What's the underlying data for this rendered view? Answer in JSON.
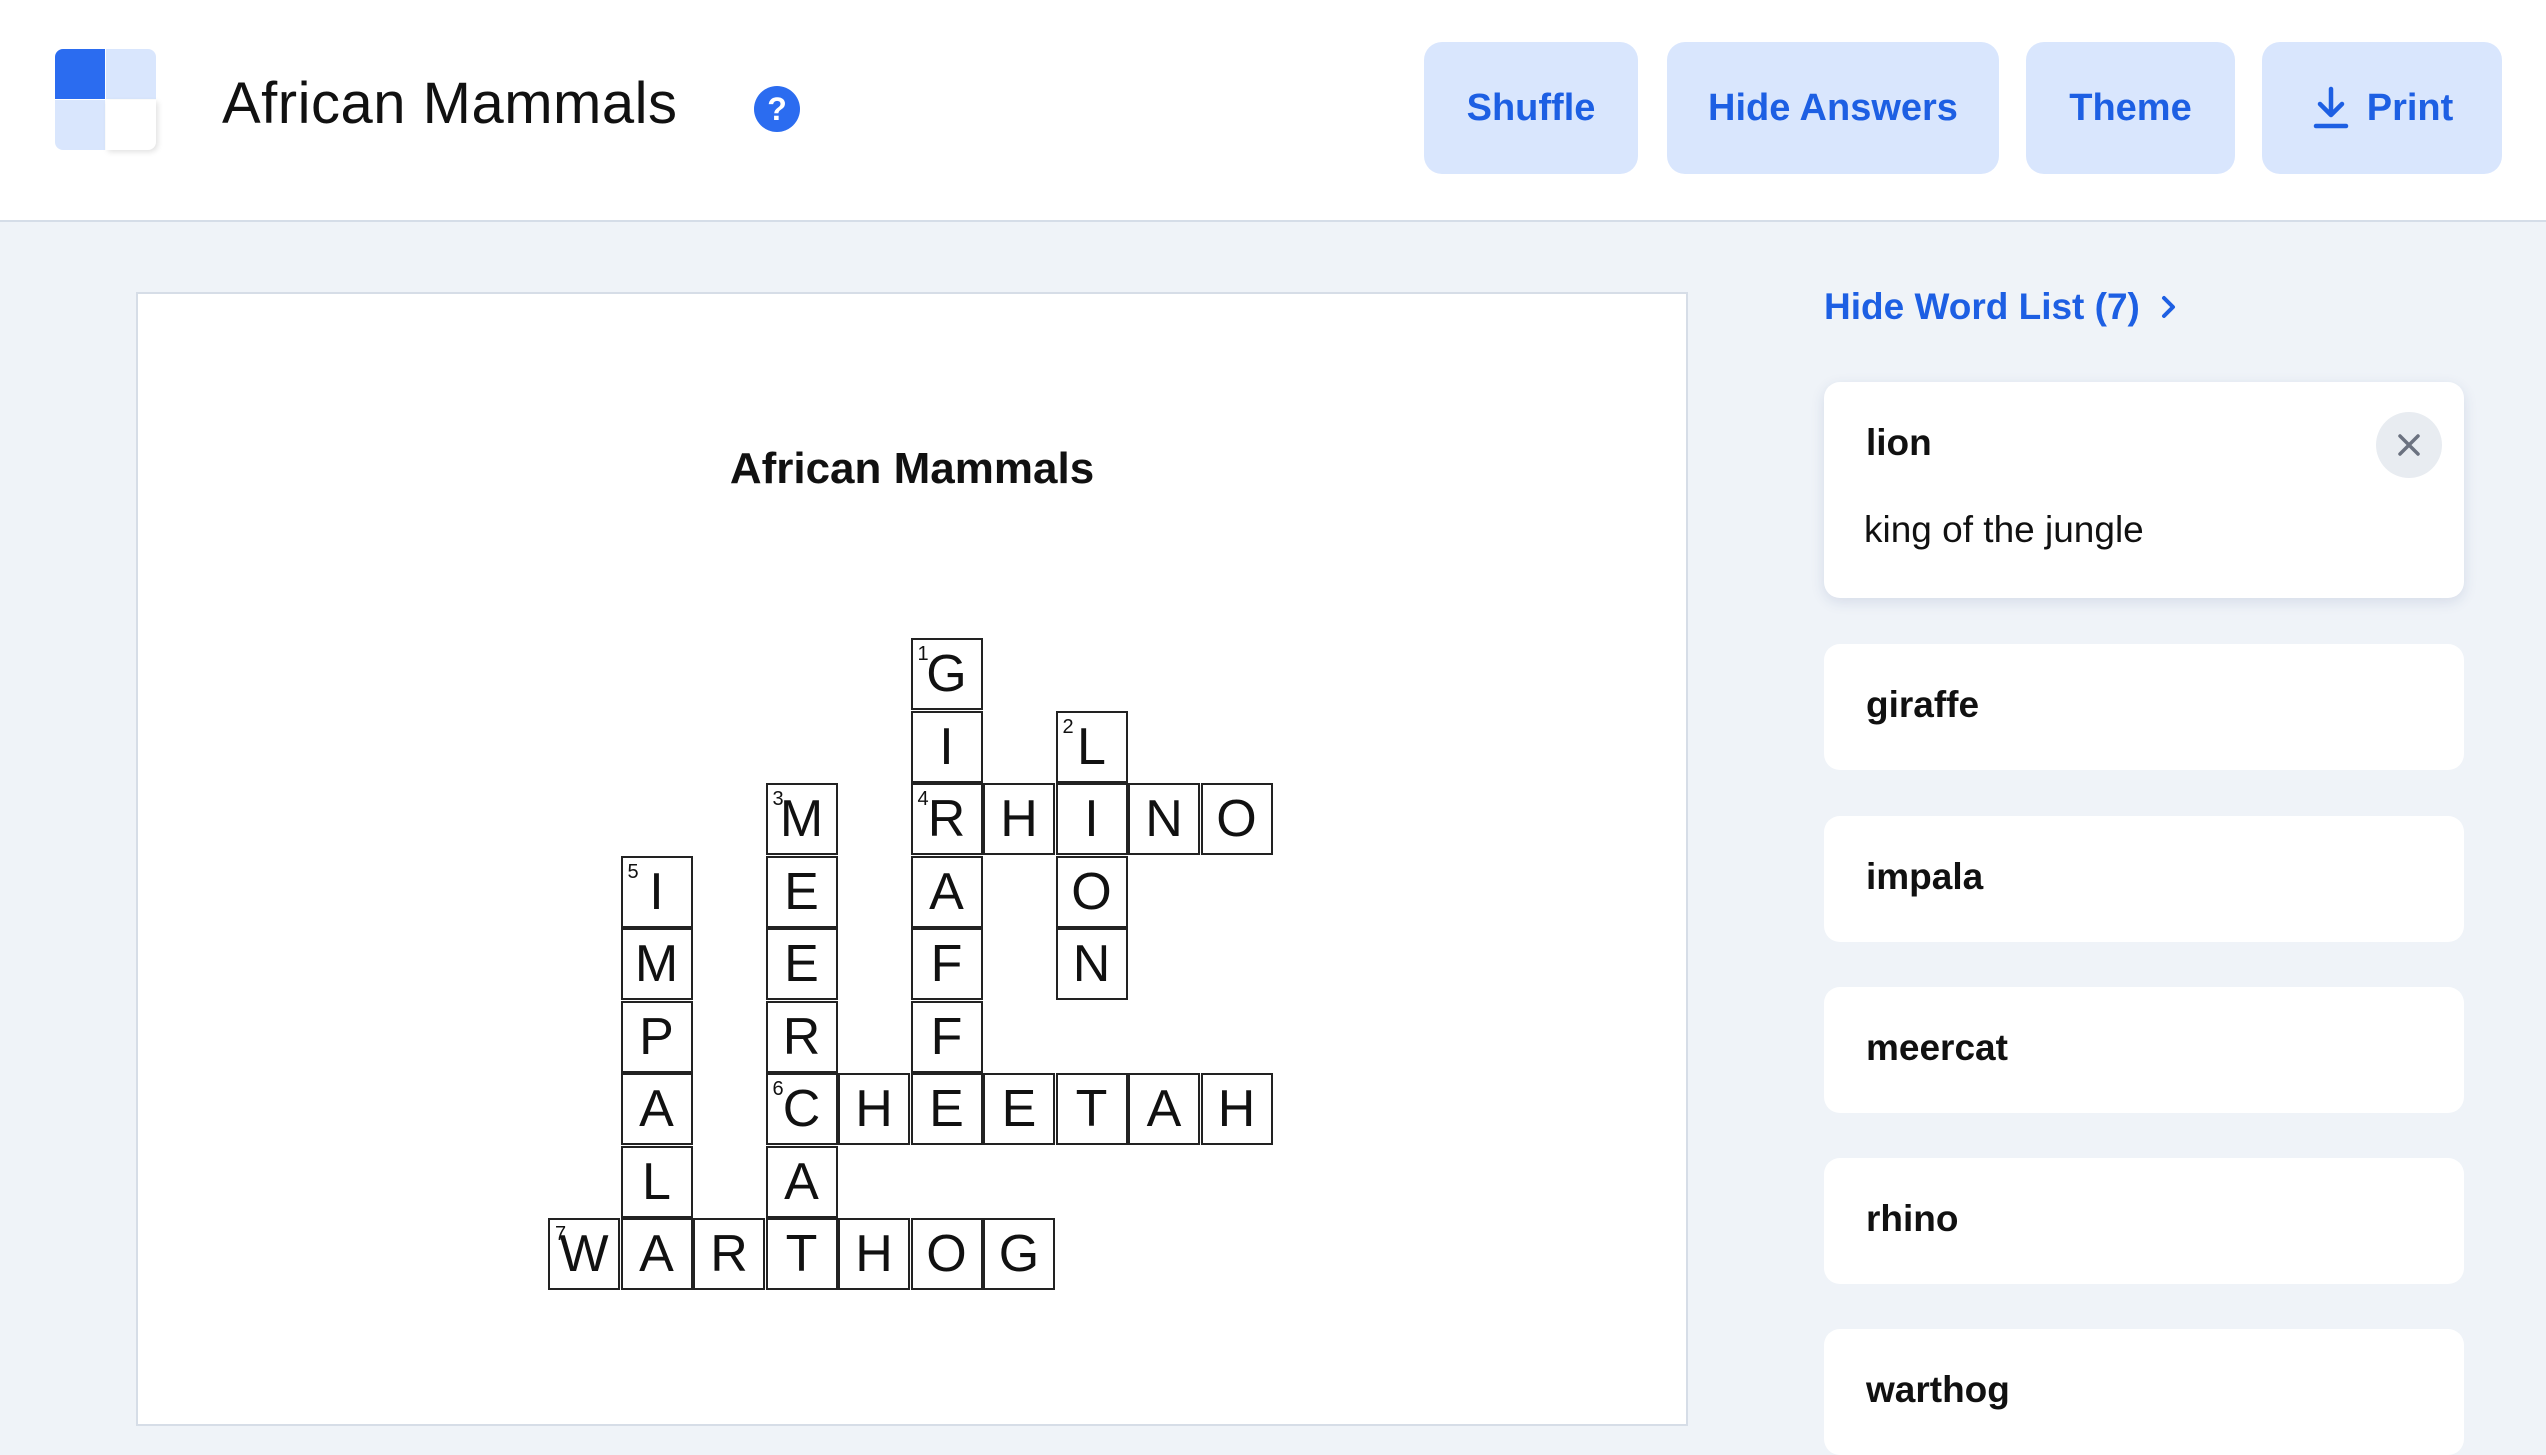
{
  "header": {
    "title": "African Mammals",
    "help_icon_glyph": "?",
    "buttons": {
      "shuffle": "Shuffle",
      "hide_answers": "Hide Answers",
      "theme": "Theme",
      "print": "Print"
    }
  },
  "puzzle": {
    "title": "African Mammals",
    "cells": [
      {
        "r": 0,
        "c": 5,
        "ch": "G",
        "n": "1"
      },
      {
        "r": 1,
        "c": 5,
        "ch": "I"
      },
      {
        "r": 1,
        "c": 7,
        "ch": "L",
        "n": "2"
      },
      {
        "r": 2,
        "c": 3,
        "ch": "M",
        "n": "3"
      },
      {
        "r": 2,
        "c": 5,
        "ch": "R",
        "n": "4"
      },
      {
        "r": 2,
        "c": 6,
        "ch": "H"
      },
      {
        "r": 2,
        "c": 7,
        "ch": "I"
      },
      {
        "r": 2,
        "c": 8,
        "ch": "N"
      },
      {
        "r": 2,
        "c": 9,
        "ch": "O"
      },
      {
        "r": 3,
        "c": 1,
        "ch": "I",
        "n": "5"
      },
      {
        "r": 3,
        "c": 3,
        "ch": "E"
      },
      {
        "r": 3,
        "c": 5,
        "ch": "A"
      },
      {
        "r": 3,
        "c": 7,
        "ch": "O"
      },
      {
        "r": 4,
        "c": 1,
        "ch": "M"
      },
      {
        "r": 4,
        "c": 3,
        "ch": "E"
      },
      {
        "r": 4,
        "c": 5,
        "ch": "F"
      },
      {
        "r": 4,
        "c": 7,
        "ch": "N"
      },
      {
        "r": 5,
        "c": 1,
        "ch": "P"
      },
      {
        "r": 5,
        "c": 3,
        "ch": "R"
      },
      {
        "r": 5,
        "c": 5,
        "ch": "F"
      },
      {
        "r": 6,
        "c": 1,
        "ch": "A"
      },
      {
        "r": 6,
        "c": 3,
        "ch": "C",
        "n": "6"
      },
      {
        "r": 6,
        "c": 4,
        "ch": "H"
      },
      {
        "r": 6,
        "c": 5,
        "ch": "E"
      },
      {
        "r": 6,
        "c": 6,
        "ch": "E"
      },
      {
        "r": 6,
        "c": 7,
        "ch": "T"
      },
      {
        "r": 6,
        "c": 8,
        "ch": "A"
      },
      {
        "r": 6,
        "c": 9,
        "ch": "H"
      },
      {
        "r": 7,
        "c": 1,
        "ch": "L"
      },
      {
        "r": 7,
        "c": 3,
        "ch": "A"
      },
      {
        "r": 8,
        "c": 0,
        "ch": "W",
        "n": "7"
      },
      {
        "r": 8,
        "c": 1,
        "ch": "A"
      },
      {
        "r": 8,
        "c": 2,
        "ch": "R"
      },
      {
        "r": 8,
        "c": 3,
        "ch": "T"
      },
      {
        "r": 8,
        "c": 4,
        "ch": "H"
      },
      {
        "r": 8,
        "c": 5,
        "ch": "O"
      },
      {
        "r": 8,
        "c": 6,
        "ch": "G"
      }
    ]
  },
  "word_list": {
    "toggle_label": "Hide Word List (7)",
    "active": {
      "word": "lion",
      "clue": "king of the jungle"
    },
    "words": [
      "giraffe",
      "impala",
      "meercat",
      "rhino",
      "warthog"
    ]
  }
}
